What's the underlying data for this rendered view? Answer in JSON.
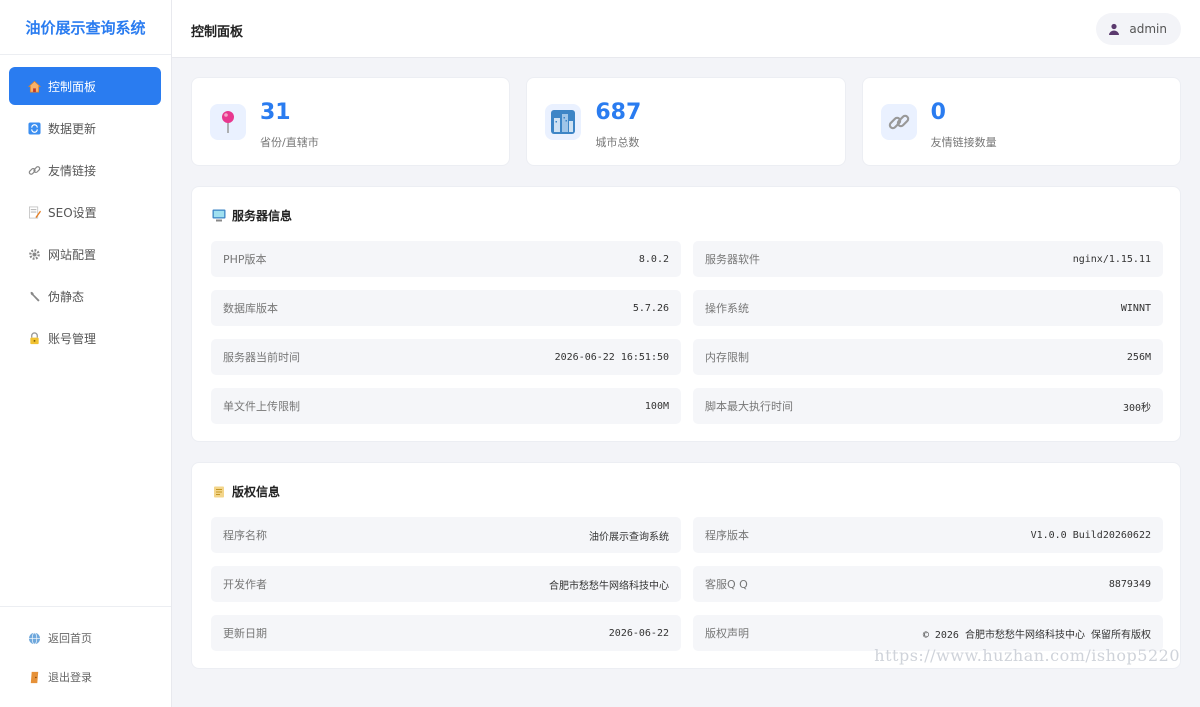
{
  "brand": "油价展示查询系统",
  "sidebar": {
    "items": [
      {
        "label": "控制面板",
        "icon": "house-icon",
        "active": true
      },
      {
        "label": "数据更新",
        "icon": "refresh-icon"
      },
      {
        "label": "友情链接",
        "icon": "link-icon"
      },
      {
        "label": "SEO设置",
        "icon": "memo-icon"
      },
      {
        "label": "网站配置",
        "icon": "gear-icon"
      },
      {
        "label": "伪静态",
        "icon": "wrench-icon"
      },
      {
        "label": "账号管理",
        "icon": "lock-icon"
      }
    ],
    "bottom": [
      {
        "label": "返回首页",
        "icon": "globe-icon"
      },
      {
        "label": "退出登录",
        "icon": "door-icon"
      }
    ]
  },
  "header": {
    "title": "控制面板",
    "user": "admin"
  },
  "stats": [
    {
      "value": "31",
      "label": "省份/直辖市",
      "icon": "pin-icon"
    },
    {
      "value": "687",
      "label": "城市总数",
      "icon": "city-icon"
    },
    {
      "value": "0",
      "label": "友情链接数量",
      "icon": "link-icon"
    }
  ],
  "server": {
    "title": "服务器信息",
    "rows": [
      {
        "k": "PHP版本",
        "v": "8.0.2"
      },
      {
        "k": "服务器软件",
        "v": "nginx/1.15.11"
      },
      {
        "k": "数据库版本",
        "v": "5.7.26"
      },
      {
        "k": "操作系统",
        "v": "WINNT"
      },
      {
        "k": "服务器当前时间",
        "v": "2026-06-22 16:51:50"
      },
      {
        "k": "内存限制",
        "v": "256M"
      },
      {
        "k": "单文件上传限制",
        "v": "100M"
      },
      {
        "k": "脚本最大执行时间",
        "v": "300秒"
      }
    ]
  },
  "copyright": {
    "title": "版权信息",
    "rows": [
      {
        "k": "程序名称",
        "v": "油价展示查询系统"
      },
      {
        "k": "程序版本",
        "v": "V1.0.0 Build20260622"
      },
      {
        "k": "开发作者",
        "v": "合肥市愁愁牛网络科技中心"
      },
      {
        "k": "客服Q Q",
        "v": "8879349"
      },
      {
        "k": "更新日期",
        "v": "2026-06-22"
      },
      {
        "k": "版权声明",
        "v": "© 2026 合肥市愁愁牛网络科技中心 保留所有版权"
      }
    ]
  },
  "watermark": "https://www.huzhan.com/ishop5220",
  "colors": {
    "accent": "#2a7cf0",
    "background": "#f3f4f8"
  }
}
